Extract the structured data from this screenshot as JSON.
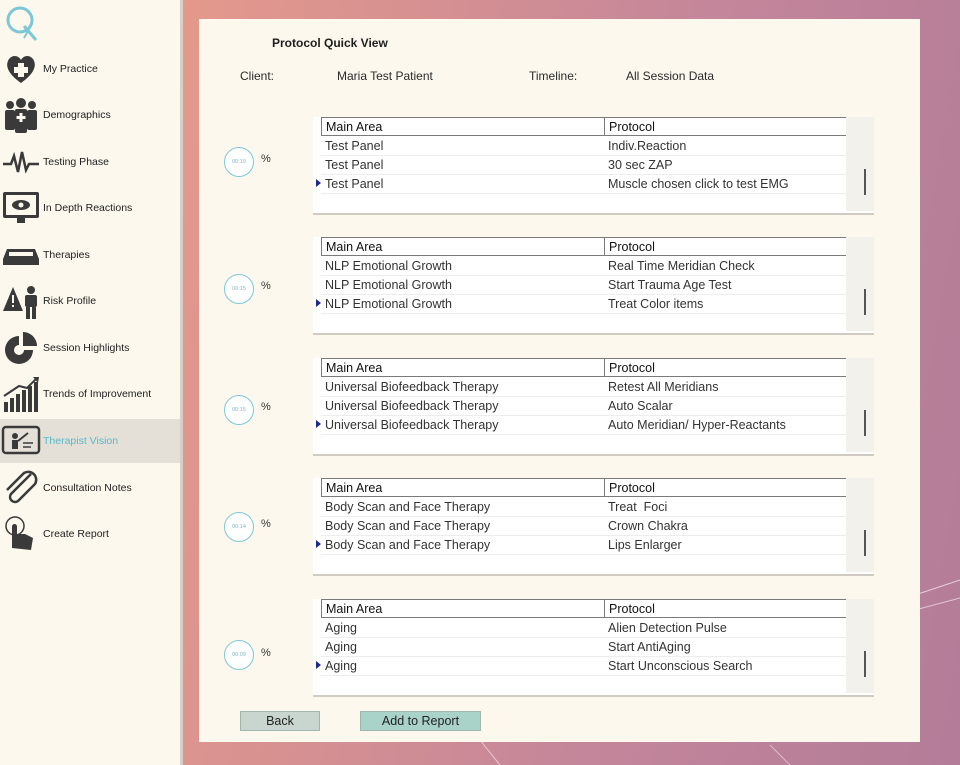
{
  "sidebar": {
    "items": [
      {
        "label": "My Practice",
        "icon": "heart-plus-icon",
        "active": false
      },
      {
        "label": "Demographics",
        "icon": "people-group-icon",
        "active": false
      },
      {
        "label": "Testing Phase",
        "icon": "pulse-wave-icon",
        "active": false
      },
      {
        "label": "In Depth Reactions",
        "icon": "monitor-eye-icon",
        "active": false
      },
      {
        "label": "Therapies",
        "icon": "device-tray-icon",
        "active": false
      },
      {
        "label": "Risk Profile",
        "icon": "risk-person-icon",
        "active": false
      },
      {
        "label": "Session Highlights",
        "icon": "pie-chart-icon",
        "active": false
      },
      {
        "label": "Trends of Improvement",
        "icon": "bar-trend-icon",
        "active": false
      },
      {
        "label": "Therapist Vision",
        "icon": "therapist-screen-icon",
        "active": true
      },
      {
        "label": "Consultation Notes",
        "icon": "paperclip-icon",
        "active": false
      },
      {
        "label": "Create Report",
        "icon": "hand-pointer-icon",
        "active": false
      }
    ]
  },
  "header": {
    "title": "Protocol Quick View",
    "client_label": "Client:",
    "client_value": "Maria Test Patient",
    "timeline_label": "Timeline:",
    "timeline_value": "All Session Data"
  },
  "columns": {
    "main_area": "Main Area",
    "protocol": "Protocol"
  },
  "blocks": [
    {
      "timer": "00:19",
      "pct": "%",
      "rows": [
        {
          "main_area": "Test Panel",
          "protocol": "Indiv.Reaction"
        },
        {
          "main_area": "Test Panel",
          "protocol": "30 sec ZAP"
        },
        {
          "main_area": "Test Panel",
          "protocol": "Muscle chosen click to test EMG"
        }
      ]
    },
    {
      "timer": "00:15",
      "pct": "%",
      "rows": [
        {
          "main_area": "NLP Emotional Growth",
          "protocol": "Real Time Meridian Check"
        },
        {
          "main_area": "NLP Emotional Growth",
          "protocol": "Start Trauma Age Test"
        },
        {
          "main_area": "NLP Emotional Growth",
          "protocol": "Treat Color items"
        }
      ]
    },
    {
      "timer": "00:15",
      "pct": "%",
      "rows": [
        {
          "main_area": "Universal Biofeedback Therapy",
          "protocol": "Retest All Meridians"
        },
        {
          "main_area": "Universal Biofeedback Therapy",
          "protocol": "Auto Scalar"
        },
        {
          "main_area": "Universal Biofeedback Therapy",
          "protocol": "Auto Meridian/ Hyper-Reactants"
        }
      ]
    },
    {
      "timer": "00:14",
      "pct": "%",
      "rows": [
        {
          "main_area": "Body Scan and Face Therapy",
          "protocol": "Treat  Foci"
        },
        {
          "main_area": "Body Scan and Face Therapy",
          "protocol": "Crown Chakra"
        },
        {
          "main_area": "Body Scan and Face Therapy",
          "protocol": "Lips Enlarger"
        }
      ]
    },
    {
      "timer": "00:09",
      "pct": "%",
      "rows": [
        {
          "main_area": "Aging",
          "protocol": "Alien Detection Pulse"
        },
        {
          "main_area": "Aging",
          "protocol": "Start AntiAging"
        },
        {
          "main_area": "Aging",
          "protocol": "Start Unconscious Search"
        }
      ]
    }
  ],
  "buttons": {
    "back": "Back",
    "add_to_report": "Add to Report"
  },
  "colors": {
    "accent": "#57b9c9",
    "panel": "#fcf8ee",
    "button_back": "#c9d6cf",
    "button_add": "#a9d3c8"
  }
}
